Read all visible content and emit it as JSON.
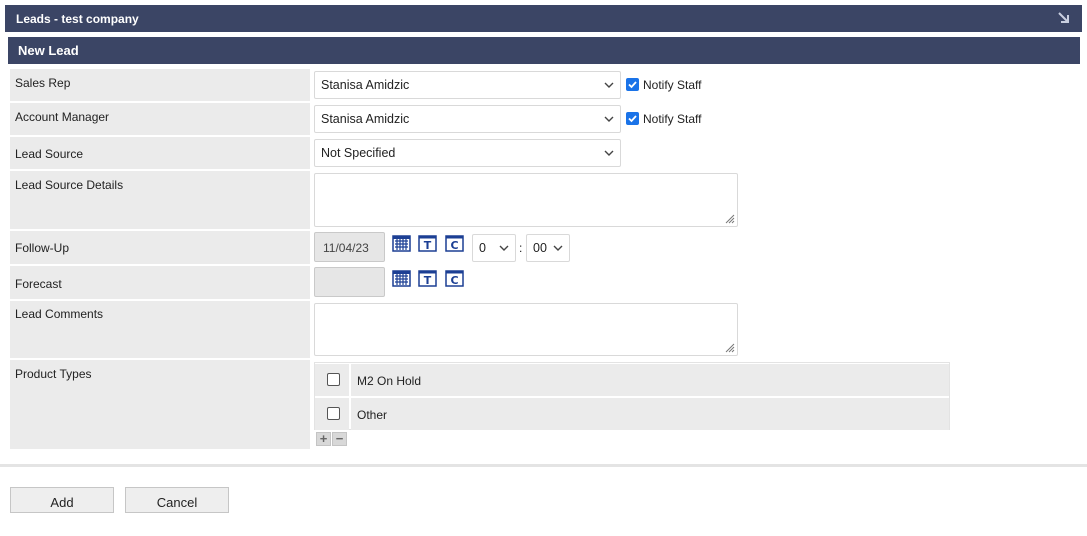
{
  "window": {
    "title": "Leads - test company"
  },
  "form": {
    "section_title": "New Lead",
    "sales_rep": {
      "label": "Sales Rep",
      "value": "Stanisa Amidzic",
      "notify_label": "Notify Staff",
      "notify_checked": true
    },
    "account_manager": {
      "label": "Account Manager",
      "value": "Stanisa Amidzic",
      "notify_label": "Notify Staff",
      "notify_checked": true
    },
    "lead_source": {
      "label": "Lead Source",
      "value": "Not Specified"
    },
    "lead_source_details": {
      "label": "Lead Source Details",
      "value": ""
    },
    "follow_up": {
      "label": "Follow-Up",
      "date": "11/04/23",
      "hour": "0",
      "separator": ":",
      "minute": "00"
    },
    "forecast": {
      "label": "Forecast",
      "date": ""
    },
    "lead_comments": {
      "label": "Lead Comments",
      "value": ""
    },
    "product_types": {
      "label": "Product Types",
      "items": [
        {
          "name": "M2 On Hold",
          "checked": false
        },
        {
          "name": "Other",
          "checked": false
        }
      ],
      "add_label": "+",
      "remove_label": "−"
    }
  },
  "icons": {
    "calendar": "calendar-icon",
    "today": "T",
    "clear": "C"
  },
  "buttons": {
    "add": "Add",
    "cancel": "Cancel"
  },
  "colors": {
    "header_bg": "#3b4565",
    "label_bg": "#ebebeb",
    "checkbox_accent": "#1a73e8",
    "icon_blue": "#1c3f94"
  }
}
